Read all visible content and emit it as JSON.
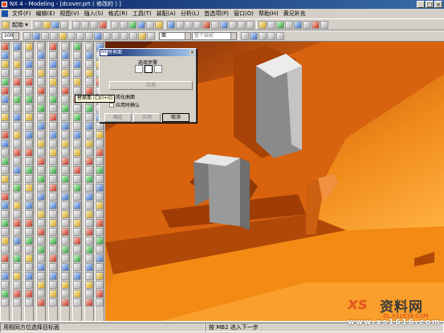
{
  "title": "NX 4 - Modeling - [dcover.prt ( 修改的 ) ]",
  "window_buttons": [
    "_",
    "□",
    "×"
  ],
  "menu": [
    "文件(F)",
    "编辑(E)",
    "视图(V)",
    "插入(S)",
    "格式(R)",
    "工具(T)",
    "装配(A)",
    "分析(L)",
    "首选项(P)",
    "窗口(O)",
    "帮助(H)",
    "黄兄补充"
  ],
  "toolbar": {
    "start_label": "起始 ▾",
    "zoom_value": "100",
    "filter_value": "面",
    "filter_secondary": "整个装配"
  },
  "dialog": {
    "title": "替换面",
    "nx_tag": "NX",
    "close": "×",
    "group_label": "选择步骤",
    "apply_top": "应用",
    "check_simplify": "简化曲面",
    "check_apply_confirm": "应用时确认",
    "ok": "确定",
    "apply": "应用",
    "cancel": "取消"
  },
  "tooltip": "替换面 (Ctrl+0)",
  "status": {
    "left": "用相同方位选择目标面",
    "right": "按 MB2 进入下一步"
  },
  "watermark": {
    "logo": "xs",
    "text": "资料网",
    "url": "ZL.XS1616.COM",
    "url2": "www.xs1616.com"
  },
  "colors": {
    "viewport_orange": "#f08a1a",
    "part_gray": "#b8b8b8",
    "titlebar_blue": "#0a246a"
  }
}
